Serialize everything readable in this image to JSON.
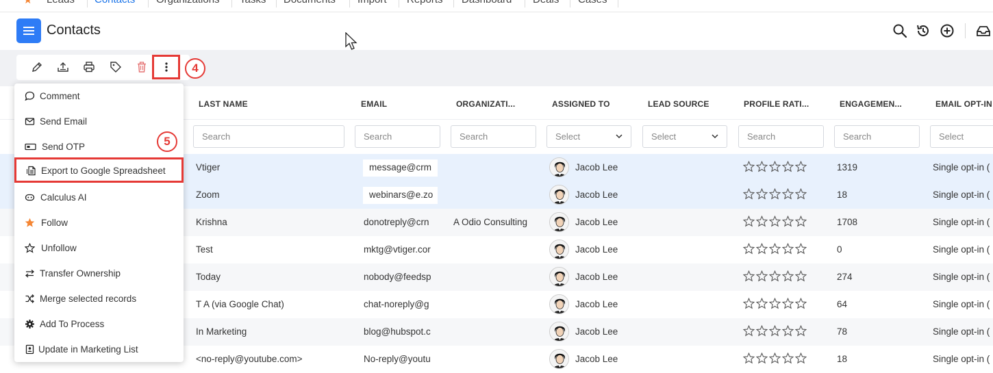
{
  "module_tabs": [
    "Leads",
    "Contacts",
    "Organizations",
    "Tasks",
    "Documents",
    "Import",
    "Reports",
    "Dashboard",
    "Deals",
    "Cases"
  ],
  "active_tab": "Contacts",
  "header": {
    "title": "Contacts"
  },
  "annotations": {
    "step4": "4",
    "step5": "5"
  },
  "columns": [
    "LAST NAME",
    "EMAIL",
    "ORGANIZATI...",
    "ASSIGNED TO",
    "LEAD SOURCE",
    "PROFILE RATI...",
    "ENGAGEMEN...",
    "EMAIL OPT-IN"
  ],
  "filters": {
    "search_placeholder": "Search",
    "select_placeholder": "Select"
  },
  "rows": [
    {
      "last_name": "Vtiger",
      "email": "message@crm",
      "organization": "",
      "assigned_to": "Jacob Lee",
      "engagement": "1319",
      "opt_in": "Single opt-in ("
    },
    {
      "last_name": "Zoom",
      "email": "webinars@e.zo",
      "organization": "",
      "assigned_to": "Jacob Lee",
      "engagement": "18",
      "opt_in": "Single opt-in ("
    },
    {
      "last_name": "Krishna",
      "email": "donotreply@crn",
      "organization": "A Odio Consulting",
      "assigned_to": "Jacob Lee",
      "engagement": "1708",
      "opt_in": "Single opt-in ("
    },
    {
      "last_name": "Test",
      "email": "mktg@vtiger.cor",
      "organization": "",
      "assigned_to": "Jacob Lee",
      "engagement": "0",
      "opt_in": "Single opt-in ("
    },
    {
      "last_name": "Today",
      "email": "nobody@feedsp",
      "organization": "",
      "assigned_to": "Jacob Lee",
      "engagement": "274",
      "opt_in": "Single opt-in ("
    },
    {
      "last_name": "T A (via Google Chat)",
      "email": "chat-noreply@g",
      "organization": "",
      "assigned_to": "Jacob Lee",
      "engagement": "64",
      "opt_in": "Single opt-in ("
    },
    {
      "last_name": "In Marketing",
      "email": "blog@hubspot.c",
      "organization": "",
      "assigned_to": "Jacob Lee",
      "engagement": "78",
      "opt_in": "Single opt-in ("
    },
    {
      "last_name": "<no-reply@youtube.com>",
      "email": "No-reply@youtu",
      "organization": "",
      "assigned_to": "Jacob Lee",
      "engagement": "18",
      "opt_in": "Single opt-in ("
    }
  ],
  "menu": {
    "items": [
      {
        "label": "Comment",
        "icon": "comment-icon"
      },
      {
        "label": "Send Email",
        "icon": "envelope-icon"
      },
      {
        "label": "Send OTP",
        "icon": "otp-icon"
      },
      {
        "label": "Export to Google Spreadsheet",
        "icon": "spreadsheet-icon"
      },
      {
        "label": "Calculus AI",
        "icon": "ai-icon"
      },
      {
        "label": "Follow",
        "icon": "star-filled-icon"
      },
      {
        "label": "Unfollow",
        "icon": "star-outline-icon"
      },
      {
        "label": "Transfer Ownership",
        "icon": "transfer-icon"
      },
      {
        "label": "Merge selected records",
        "icon": "merge-icon"
      },
      {
        "label": "Add To Process",
        "icon": "gear-icon"
      },
      {
        "label": "Update in Marketing List",
        "icon": "contact-card-icon"
      }
    ]
  },
  "colors": {
    "accent": "#2e7cf6",
    "highlight": "#e53935",
    "follow_star": "#f58634",
    "delete": "#e57373"
  }
}
